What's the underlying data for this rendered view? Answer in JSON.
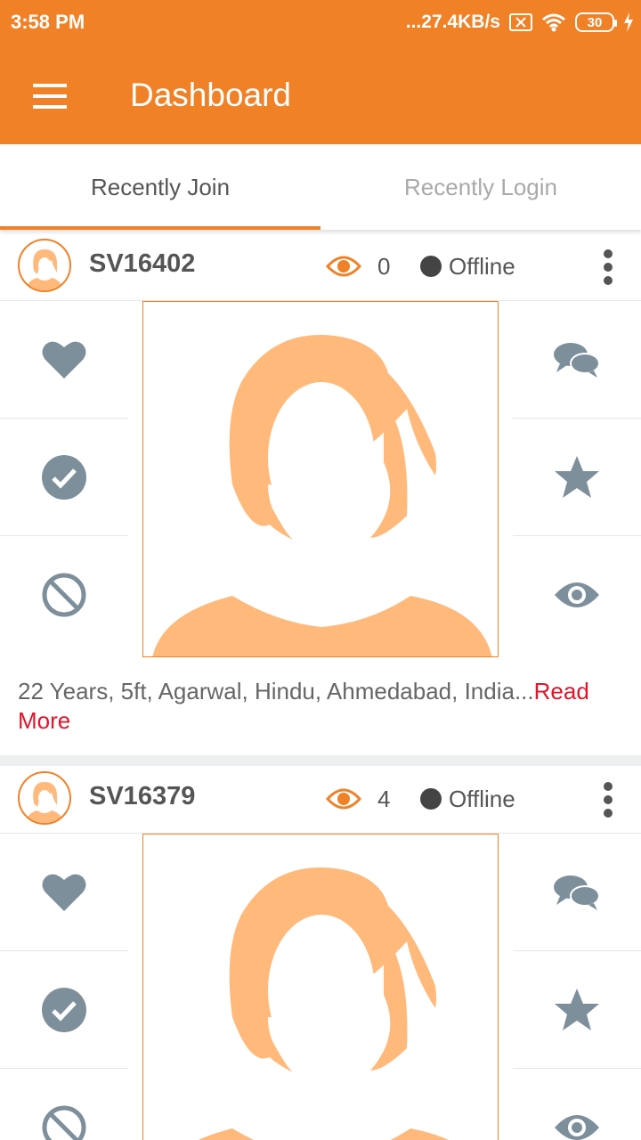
{
  "status_bar": {
    "time": "3:58 PM",
    "net_speed": "...27.4KB/s",
    "battery": "30"
  },
  "app_bar": {
    "title": "Dashboard"
  },
  "tabs": [
    {
      "label": "Recently Join",
      "active": true
    },
    {
      "label": "Recently Login",
      "active": false
    }
  ],
  "profiles": [
    {
      "id": "SV16402",
      "views": "0",
      "status": "Offline",
      "bio": "22 Years, 5ft, Agarwal, Hindu, Ahmedabad, India...",
      "read_more": "Read More"
    },
    {
      "id": "SV16379",
      "views": "4",
      "status": "Offline"
    }
  ],
  "icons": {
    "left_actions": [
      "heart-icon",
      "check-circle-icon",
      "block-icon"
    ],
    "right_actions": [
      "chat-icon",
      "star-icon",
      "eye-icon"
    ]
  },
  "colors": {
    "primary": "#f08127",
    "icon_gray": "#7e8f9c",
    "avatar_fill": "#ffb97a",
    "read_more": "#e0142a",
    "status_offline": "#444444"
  }
}
